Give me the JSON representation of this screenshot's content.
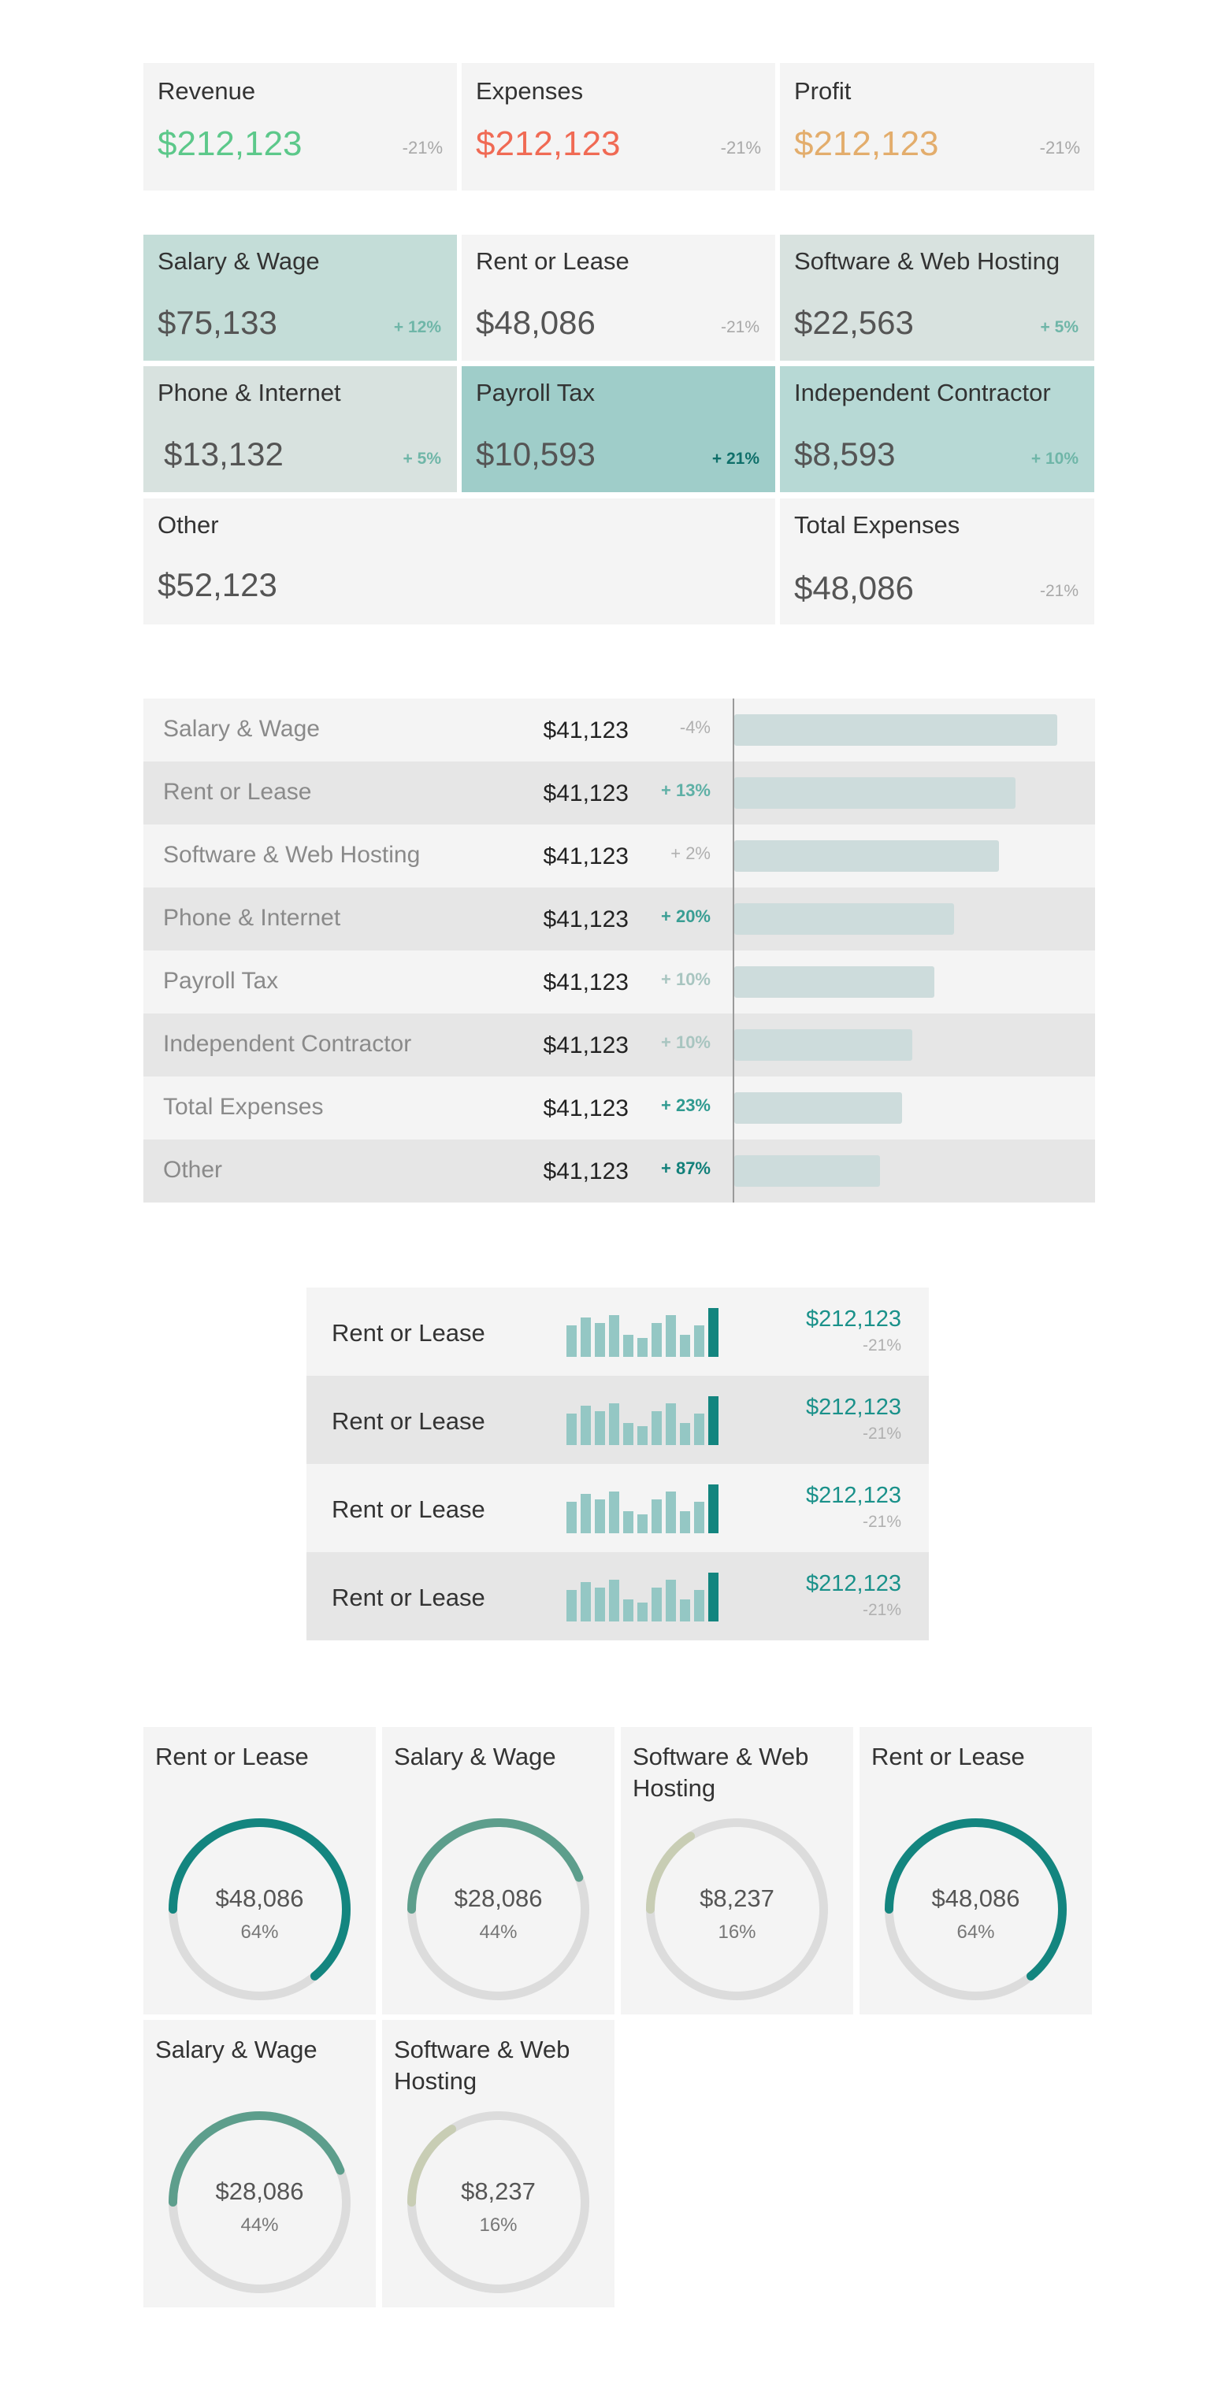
{
  "summary": [
    {
      "title": "Revenue",
      "value": "$212,123",
      "change": "-21%",
      "color": "#5cc88a"
    },
    {
      "title": "Expenses",
      "value": "$212,123",
      "change": "-21%",
      "color": "#f06a54"
    },
    {
      "title": "Profit",
      "value": "$212,123",
      "change": "-21%",
      "color": "#e3ad6c"
    }
  ],
  "tiles": [
    {
      "title": "Salary & Wage",
      "value": "$75,133",
      "change": "+ 12%",
      "bg": "#c4ddd8",
      "change_color": "#6fb6a8"
    },
    {
      "title": "Rent or Lease",
      "value": "$48,086",
      "change": "-21%",
      "bg": "#f4f4f4",
      "change_color": "#a8a8a8"
    },
    {
      "title": "Software & Web Hosting",
      "value": "$22,563",
      "change": "+ 5%",
      "bg": "#d8e2df",
      "change_color": "#6fb6a8"
    },
    {
      "title": "Phone & Internet",
      "value": "$13,132",
      "change": "+ 5%",
      "bg": "#d8e2df",
      "change_color": "#6fb6a8"
    },
    {
      "title": "Payroll Tax",
      "value": "$10,593",
      "change": "+ 21%",
      "bg": "#9fcdc9",
      "change_color": "#0f6f6a"
    },
    {
      "title": "Independent Contractor",
      "value": "$8,593",
      "change": "+ 10%",
      "bg": "#b7d9d5",
      "change_color": "#6fb6a8"
    },
    {
      "title": "Other",
      "value": "$52,123",
      "change": "",
      "bg": "#f4f4f4",
      "change_color": "#a8a8a8"
    },
    {
      "title": "Total Expenses",
      "value": "$48,086",
      "change": "-21%",
      "bg": "#f4f4f4",
      "change_color": "#a8a8a8"
    }
  ],
  "table": {
    "rows": [
      {
        "label": "Salary & Wage",
        "amount": "$41,123",
        "change": "-4%",
        "bar": 1.0,
        "change_color": "#b0b0b0"
      },
      {
        "label": "Rent or Lease",
        "amount": "$41,123",
        "change": "+ 13%",
        "bar": 0.87,
        "change_color": "#5fb0a6"
      },
      {
        "label": "Software & Web Hosting",
        "amount": "$41,123",
        "change": "+ 2%",
        "bar": 0.82,
        "change_color": "#b0b0b0"
      },
      {
        "label": "Phone & Internet",
        "amount": "$41,123",
        "change": "+ 20%",
        "bar": 0.68,
        "change_color": "#3a9e94"
      },
      {
        "label": "Payroll Tax",
        "amount": "$41,123",
        "change": "+ 10%",
        "bar": 0.62,
        "change_color": "#a8c5c0"
      },
      {
        "label": "Independent Contractor",
        "amount": "$41,123",
        "change": "+ 10%",
        "bar": 0.55,
        "change_color": "#a8c5c0"
      },
      {
        "label": "Total Expenses",
        "amount": "$41,123",
        "change": "+ 23%",
        "bar": 0.52,
        "change_color": "#2f9a90"
      },
      {
        "label": "Other",
        "amount": "$41,123",
        "change": "+ 87%",
        "bar": 0.45,
        "change_color": "#12807a"
      }
    ]
  },
  "sparklist": [
    {
      "label": "Rent or Lease",
      "value": "$212,123",
      "change": "-21%",
      "bars": [
        0.65,
        0.8,
        0.7,
        0.85,
        0.45,
        0.38,
        0.7,
        0.85,
        0.45,
        0.65,
        1.0
      ]
    },
    {
      "label": "Rent or Lease",
      "value": "$212,123",
      "change": "-21%",
      "bars": [
        0.65,
        0.8,
        0.7,
        0.85,
        0.45,
        0.38,
        0.7,
        0.85,
        0.45,
        0.65,
        1.0
      ]
    },
    {
      "label": "Rent or Lease",
      "value": "$212,123",
      "change": "-21%",
      "bars": [
        0.65,
        0.8,
        0.7,
        0.85,
        0.45,
        0.38,
        0.7,
        0.85,
        0.45,
        0.65,
        1.0
      ]
    },
    {
      "label": "Rent or Lease",
      "value": "$212,123",
      "change": "-21%",
      "bars": [
        0.65,
        0.8,
        0.7,
        0.85,
        0.45,
        0.38,
        0.7,
        0.85,
        0.45,
        0.65,
        1.0
      ]
    }
  ],
  "gauges": [
    {
      "title": "Rent or Lease",
      "value": "$48,086",
      "pct": "64%",
      "fraction": 0.64,
      "color": "#13857f"
    },
    {
      "title": "Salary & Wage",
      "value": "$28,086",
      "pct": "44%",
      "fraction": 0.44,
      "color": "#5d9e8c"
    },
    {
      "title": "Software & Web Hosting",
      "value": "$8,237",
      "pct": "16%",
      "fraction": 0.16,
      "color": "#c8cdb4"
    },
    {
      "title": "Rent or Lease",
      "value": "$48,086",
      "pct": "64%",
      "fraction": 0.64,
      "color": "#13857f"
    },
    {
      "title": "Salary & Wage",
      "value": "$28,086",
      "pct": "44%",
      "fraction": 0.44,
      "color": "#5d9e8c"
    },
    {
      "title": "Software & Web Hosting",
      "value": "$8,237",
      "pct": "16%",
      "fraction": 0.16,
      "color": "#c8cdb4"
    }
  ]
}
